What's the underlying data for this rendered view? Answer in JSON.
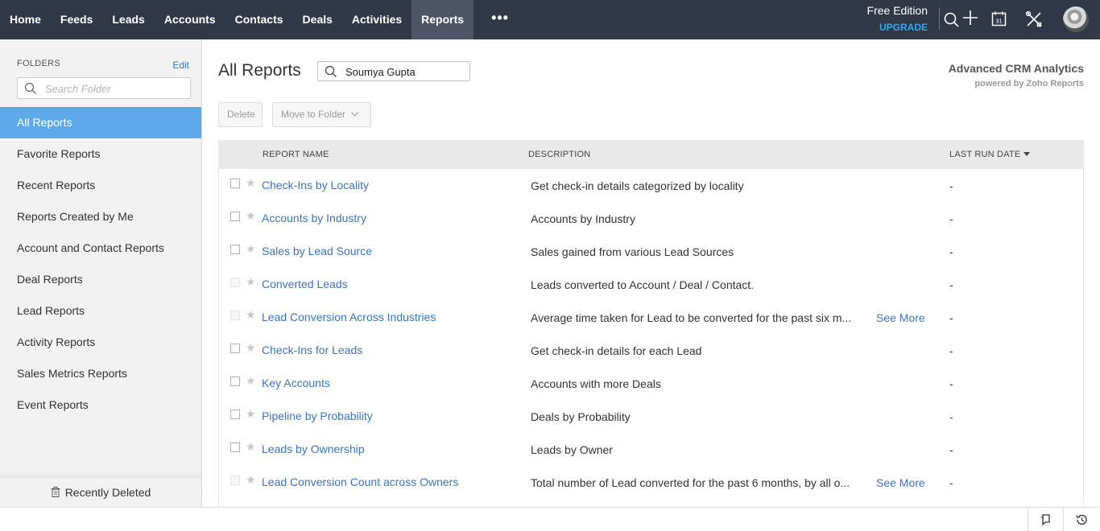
{
  "nav": {
    "tabs": [
      {
        "label": "Home"
      },
      {
        "label": "Feeds"
      },
      {
        "label": "Leads"
      },
      {
        "label": "Accounts"
      },
      {
        "label": "Contacts"
      },
      {
        "label": "Deals"
      },
      {
        "label": "Activities"
      },
      {
        "label": "Reports",
        "active": true
      }
    ],
    "more_label": "•••",
    "edition": "Free Edition",
    "upgrade": "UPGRADE",
    "icons": [
      "search-icon",
      "add-icon",
      "calendar-icon",
      "setup-icon",
      "user-avatar"
    ],
    "calendar_day": "31"
  },
  "sidebar": {
    "heading": "FOLDERS",
    "edit": "Edit",
    "search_placeholder": "Search Folder",
    "items": [
      {
        "label": "All Reports",
        "active": true
      },
      {
        "label": "Favorite Reports"
      },
      {
        "label": "Recent Reports"
      },
      {
        "label": "Reports Created by Me"
      },
      {
        "label": "Account and Contact Reports"
      },
      {
        "label": "Deal Reports"
      },
      {
        "label": "Lead Reports"
      },
      {
        "label": "Activity Reports"
      },
      {
        "label": "Sales Metrics Reports"
      },
      {
        "label": "Event Reports"
      }
    ],
    "recently_deleted": "Recently Deleted"
  },
  "main": {
    "title": "All Reports",
    "search_value": "Soumya Gupta",
    "analytics_title": "Advanced CRM Analytics",
    "analytics_sub": "powered by Zoho Reports",
    "delete_label": "Delete",
    "move_label": "Move to Folder",
    "columns": {
      "name": "REPORT NAME",
      "description": "DESCRIPTION",
      "last_run": "LAST RUN DATE"
    },
    "rows": [
      {
        "name": "Check-Ins by Locality",
        "description": "Get check-in details categorized by locality",
        "last_run": "-",
        "selectable": true
      },
      {
        "name": "Accounts by Industry",
        "description": "Accounts by Industry",
        "last_run": "-",
        "selectable": true
      },
      {
        "name": "Sales by Lead Source",
        "description": "Sales gained from various Lead Sources",
        "last_run": "-",
        "selectable": true
      },
      {
        "name": "Converted Leads",
        "description": "Leads converted to Account / Deal / Contact.",
        "last_run": "-",
        "selectable": false
      },
      {
        "name": "Lead Conversion Across Industries",
        "description": "Average time taken for Lead to be converted for the past six m...",
        "see_more": "See More",
        "last_run": "-",
        "selectable": false
      },
      {
        "name": "Check-Ins for Leads",
        "description": "Get check-in details for each Lead",
        "last_run": "-",
        "selectable": true
      },
      {
        "name": "Key Accounts",
        "description": "Accounts with more Deals",
        "last_run": "-",
        "selectable": true
      },
      {
        "name": "Pipeline by Probability",
        "description": "Deals by Probability",
        "last_run": "-",
        "selectable": true
      },
      {
        "name": "Leads by Ownership",
        "description": "Leads by Owner",
        "last_run": "-",
        "selectable": true
      },
      {
        "name": "Lead Conversion Count across Owners",
        "description": "Total number of Lead converted for the past 6 months, by all o...",
        "see_more": "See More",
        "last_run": "-",
        "selectable": false
      }
    ]
  },
  "colors": {
    "nav_bg": "#313949",
    "nav_active": "#4d5566",
    "accent_blue": "#5da9e9",
    "link": "#3c74c2",
    "upgrade": "#2fa9ef"
  }
}
